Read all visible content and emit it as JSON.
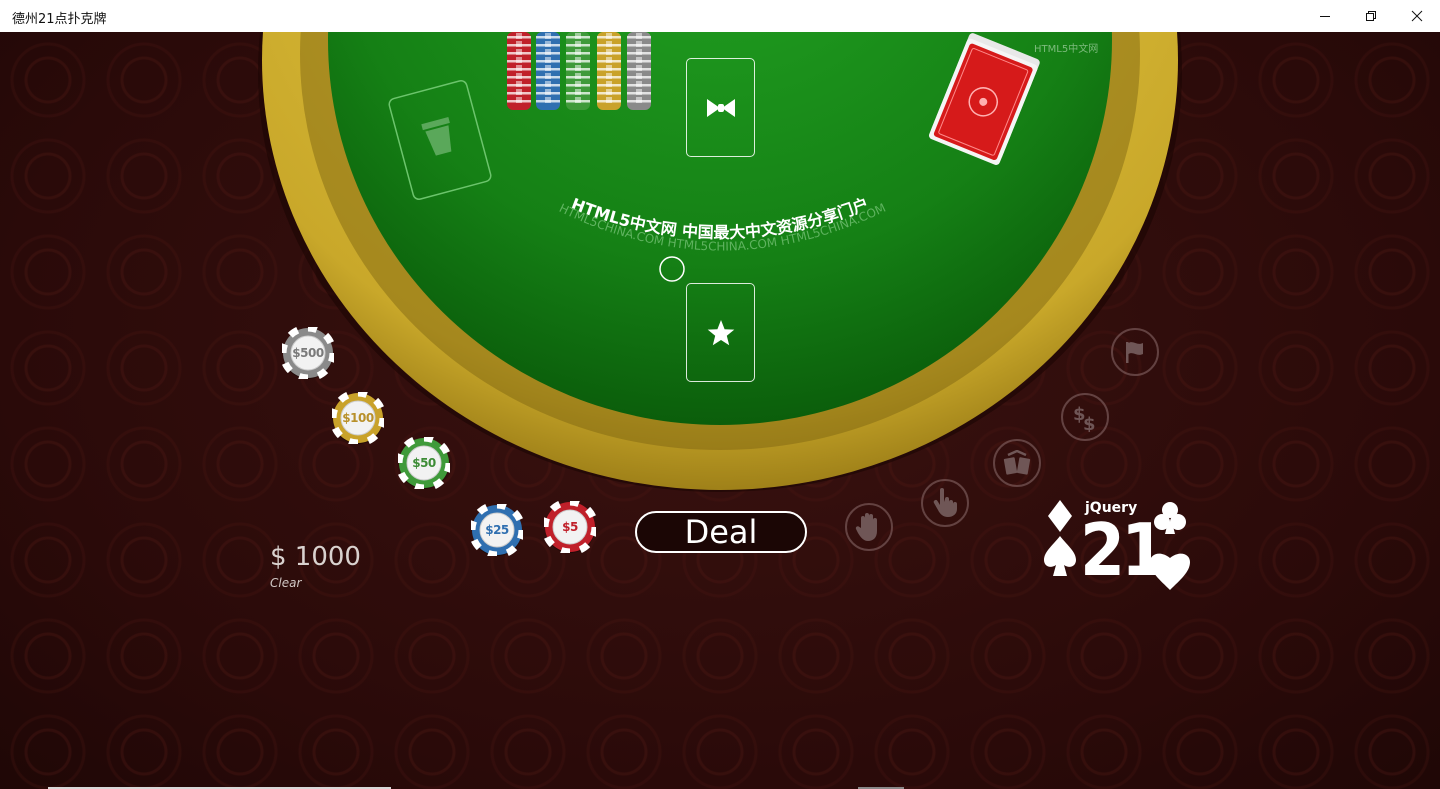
{
  "window": {
    "title": "德州21点扑克牌",
    "minimize_label": "minimize",
    "maximize_label": "maximize",
    "close_label": "close"
  },
  "table": {
    "watermark": "HTML5中文网",
    "arc_text_main": "HTML5中文网 中国最大中文资源分享门户",
    "arc_text_sub": "HTML5CHINA.COM HTML5CHINA.COM HTML5CHINA.COM",
    "felt_color": "#1a8a1a",
    "rim_color": "#c9a82a"
  },
  "chips": [
    {
      "label": "$500",
      "color": "#8a8a8a",
      "text_color": "#7a7a7a"
    },
    {
      "label": "$100",
      "color": "#c9a22a",
      "text_color": "#b8902a"
    },
    {
      "label": "$50",
      "color": "#3f9a3a",
      "text_color": "#3d8c36"
    },
    {
      "label": "$25",
      "color": "#2f6fb0",
      "text_color": "#2f6fb0"
    },
    {
      "label": "$5",
      "color": "#c0202a",
      "text_color": "#c0202a"
    }
  ],
  "chip_stacks": [
    "#c0202a",
    "#2f6fb0",
    "#3f9a3a",
    "#c9a22a",
    "#8a8a8a"
  ],
  "controls": {
    "deal_label": "Deal",
    "money": "$ 1000",
    "clear_label": "Clear"
  },
  "actions": [
    "stand-icon",
    "hit-icon",
    "split-icon",
    "double-icon",
    "surrender-icon"
  ],
  "logo": {
    "brand": "jQuery",
    "number": "21"
  }
}
